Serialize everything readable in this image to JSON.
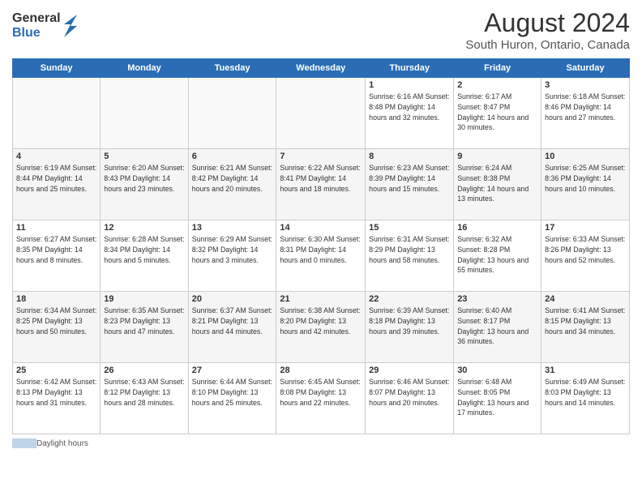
{
  "header": {
    "logo_general": "General",
    "logo_blue": "Blue",
    "main_title": "August 2024",
    "subtitle": "South Huron, Ontario, Canada"
  },
  "weekdays": [
    "Sunday",
    "Monday",
    "Tuesday",
    "Wednesday",
    "Thursday",
    "Friday",
    "Saturday"
  ],
  "weeks": [
    [
      {
        "day": "",
        "info": ""
      },
      {
        "day": "",
        "info": ""
      },
      {
        "day": "",
        "info": ""
      },
      {
        "day": "",
        "info": ""
      },
      {
        "day": "1",
        "info": "Sunrise: 6:16 AM\nSunset: 8:48 PM\nDaylight: 14 hours and 32 minutes."
      },
      {
        "day": "2",
        "info": "Sunrise: 6:17 AM\nSunset: 8:47 PM\nDaylight: 14 hours and 30 minutes."
      },
      {
        "day": "3",
        "info": "Sunrise: 6:18 AM\nSunset: 8:46 PM\nDaylight: 14 hours and 27 minutes."
      }
    ],
    [
      {
        "day": "4",
        "info": "Sunrise: 6:19 AM\nSunset: 8:44 PM\nDaylight: 14 hours and 25 minutes."
      },
      {
        "day": "5",
        "info": "Sunrise: 6:20 AM\nSunset: 8:43 PM\nDaylight: 14 hours and 23 minutes."
      },
      {
        "day": "6",
        "info": "Sunrise: 6:21 AM\nSunset: 8:42 PM\nDaylight: 14 hours and 20 minutes."
      },
      {
        "day": "7",
        "info": "Sunrise: 6:22 AM\nSunset: 8:41 PM\nDaylight: 14 hours and 18 minutes."
      },
      {
        "day": "8",
        "info": "Sunrise: 6:23 AM\nSunset: 8:39 PM\nDaylight: 14 hours and 15 minutes."
      },
      {
        "day": "9",
        "info": "Sunrise: 6:24 AM\nSunset: 8:38 PM\nDaylight: 14 hours and 13 minutes."
      },
      {
        "day": "10",
        "info": "Sunrise: 6:25 AM\nSunset: 8:36 PM\nDaylight: 14 hours and 10 minutes."
      }
    ],
    [
      {
        "day": "11",
        "info": "Sunrise: 6:27 AM\nSunset: 8:35 PM\nDaylight: 14 hours and 8 minutes."
      },
      {
        "day": "12",
        "info": "Sunrise: 6:28 AM\nSunset: 8:34 PM\nDaylight: 14 hours and 5 minutes."
      },
      {
        "day": "13",
        "info": "Sunrise: 6:29 AM\nSunset: 8:32 PM\nDaylight: 14 hours and 3 minutes."
      },
      {
        "day": "14",
        "info": "Sunrise: 6:30 AM\nSunset: 8:31 PM\nDaylight: 14 hours and 0 minutes."
      },
      {
        "day": "15",
        "info": "Sunrise: 6:31 AM\nSunset: 8:29 PM\nDaylight: 13 hours and 58 minutes."
      },
      {
        "day": "16",
        "info": "Sunrise: 6:32 AM\nSunset: 8:28 PM\nDaylight: 13 hours and 55 minutes."
      },
      {
        "day": "17",
        "info": "Sunrise: 6:33 AM\nSunset: 8:26 PM\nDaylight: 13 hours and 52 minutes."
      }
    ],
    [
      {
        "day": "18",
        "info": "Sunrise: 6:34 AM\nSunset: 8:25 PM\nDaylight: 13 hours and 50 minutes."
      },
      {
        "day": "19",
        "info": "Sunrise: 6:35 AM\nSunset: 8:23 PM\nDaylight: 13 hours and 47 minutes."
      },
      {
        "day": "20",
        "info": "Sunrise: 6:37 AM\nSunset: 8:21 PM\nDaylight: 13 hours and 44 minutes."
      },
      {
        "day": "21",
        "info": "Sunrise: 6:38 AM\nSunset: 8:20 PM\nDaylight: 13 hours and 42 minutes."
      },
      {
        "day": "22",
        "info": "Sunrise: 6:39 AM\nSunset: 8:18 PM\nDaylight: 13 hours and 39 minutes."
      },
      {
        "day": "23",
        "info": "Sunrise: 6:40 AM\nSunset: 8:17 PM\nDaylight: 13 hours and 36 minutes."
      },
      {
        "day": "24",
        "info": "Sunrise: 6:41 AM\nSunset: 8:15 PM\nDaylight: 13 hours and 34 minutes."
      }
    ],
    [
      {
        "day": "25",
        "info": "Sunrise: 6:42 AM\nSunset: 8:13 PM\nDaylight: 13 hours and 31 minutes."
      },
      {
        "day": "26",
        "info": "Sunrise: 6:43 AM\nSunset: 8:12 PM\nDaylight: 13 hours and 28 minutes."
      },
      {
        "day": "27",
        "info": "Sunrise: 6:44 AM\nSunset: 8:10 PM\nDaylight: 13 hours and 25 minutes."
      },
      {
        "day": "28",
        "info": "Sunrise: 6:45 AM\nSunset: 8:08 PM\nDaylight: 13 hours and 22 minutes."
      },
      {
        "day": "29",
        "info": "Sunrise: 6:46 AM\nSunset: 8:07 PM\nDaylight: 13 hours and 20 minutes."
      },
      {
        "day": "30",
        "info": "Sunrise: 6:48 AM\nSunset: 8:05 PM\nDaylight: 13 hours and 17 minutes."
      },
      {
        "day": "31",
        "info": "Sunrise: 6:49 AM\nSunset: 8:03 PM\nDaylight: 13 hours and 14 minutes."
      }
    ]
  ],
  "footer": {
    "legend_label": "Daylight hours"
  }
}
